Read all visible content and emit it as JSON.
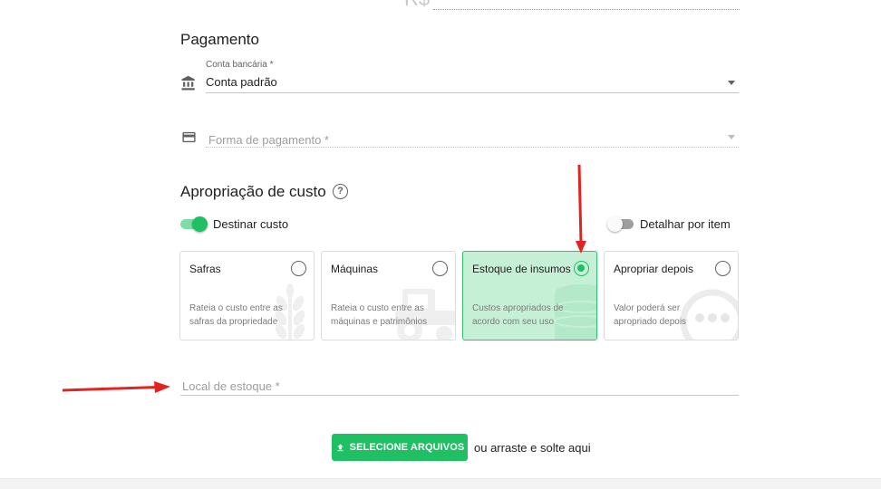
{
  "top_field": {
    "prefix": "R$"
  },
  "pagamento": {
    "title": "Pagamento",
    "conta": {
      "label": "Conta bancária *",
      "value": "Conta padrão"
    },
    "forma": {
      "placeholder": "Forma de pagamento *"
    }
  },
  "apropriacao": {
    "title": "Apropriação de custo",
    "help": "?",
    "destinar": {
      "label": "Destinar custo",
      "on": true
    },
    "detalhar": {
      "label": "Detalhar por item",
      "on": false
    },
    "cards": [
      {
        "title": "Safras",
        "desc": "Rateia o custo entre as safras da propriedade",
        "selected": false,
        "icon": "wheat-icon"
      },
      {
        "title": "Máquinas",
        "desc": "Rateia o custo entre as máquinas e patrimônios",
        "selected": false,
        "icon": "tractor-icon"
      },
      {
        "title": "Estoque de insumos",
        "desc": "Custos apropriados de acordo com seu uso",
        "selected": true,
        "icon": "storage-tank-icon"
      },
      {
        "title": "Apropriar depois",
        "desc": "Valor poderá ser apropriado depois",
        "selected": false,
        "icon": "more-dots-icon"
      }
    ]
  },
  "local_estoque": {
    "placeholder": "Local de estoque *"
  },
  "upload": {
    "button_label": "SELECIONE ARQUIVOS",
    "hint": "ou arraste e solte aqui"
  },
  "colors": {
    "accent": "#1fbf63",
    "annotation_arrow": "#e32222"
  }
}
